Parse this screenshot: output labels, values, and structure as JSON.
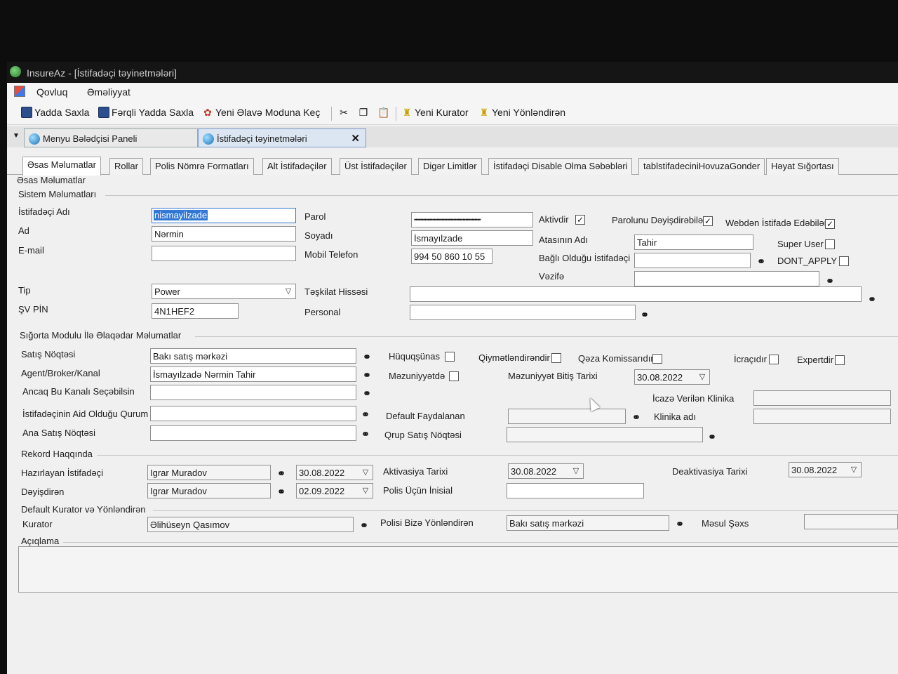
{
  "window": {
    "title": "InsureAz - [İstifadəçi təyinetmələri]"
  },
  "menu": {
    "items": [
      "Qovluq",
      "Əməliyyat"
    ]
  },
  "toolbar": {
    "save": "Yadda Saxla",
    "save_as": "Fərqli Yadda Saxla",
    "new_addon": "Yeni Əlavə Moduna Keç",
    "new_curator": "Yeni Kurator",
    "new_director": "Yeni Yönləndirən"
  },
  "doc_tabs": {
    "nav_panel": "Menyu Bələdçisi Paneli",
    "user_settings": "İstifadəçi təyinetmələri"
  },
  "form_tabs": [
    "Əsas Məlumatlar",
    "Rollar",
    "Polis Nömrə Formatları",
    "Alt İstifadəçilər",
    "Üst İstifadəçilər",
    "Digər Limitlər",
    "İstifadəçi Disable Olma Səbəbləri",
    "tablstifadeciniHovuzaGonder",
    "Həyat Sığortası"
  ],
  "sections": {
    "main": "Əsas Məlumatlar",
    "system": "Sistem Məlumatları",
    "insurance": "Sığorta Modulu İlə Əlaqədar Məlumatlar",
    "record": "Rekord Haqqında",
    "curator": "Default Kurator və Yönləndirən",
    "description": "Açıqlama"
  },
  "system": {
    "username_label": "İstifadəçi Adı",
    "username": "nismayilzade",
    "name_label": "Ad",
    "name": "Nərmin",
    "email_label": "E-mail",
    "email": "",
    "type_label": "Tip",
    "type": "Power",
    "svpin_label": "ŞV PİN",
    "svpin": "4N1HEF2",
    "password_label": "Parol",
    "password": "••••••••••••••••••••••••••••••••••••••••••••",
    "surname_label": "Soyadı",
    "surname": "İsmayılzade",
    "mobile_label": "Mobil Telefon",
    "mobile": "994 50 860 10 55",
    "unit_label": "Təşkilat Hissəsi",
    "unit": "",
    "personal_label": "Personal",
    "personal": "",
    "active_label": "Aktivdir",
    "can_change_pw_label": "Parolunu Dəyişdirəbilər",
    "web_label": "Webdən İstifadə Edəbilər",
    "father_label": "Atasının Adı",
    "father": "Tahir",
    "superuser_label": "Super User",
    "linked_user_label": "Bağlı Olduğu İstifadəçi",
    "linked_user": "",
    "dont_apply_label": "DONT_APPLY",
    "position_label": "Vəzifə",
    "position": ""
  },
  "insurance": {
    "sales_point_label": "Satış Nöqtəsi",
    "sales_point": "Bakı satış mərkəzi",
    "agent_label": "Agent/Broker/Kanal",
    "agent": "İsmayılzadə Nərmin Tahir",
    "only_channel_label": "Ancaq Bu Kanalı Seçəbilsin",
    "only_channel": "",
    "institution_label": "İstifadəçinin Aid Olduğu Qurum",
    "institution": "",
    "main_sales_point_label": "Ana Satış Nöqtəsi",
    "main_sales_point": "",
    "lawyer_label": "Hüquqşünas",
    "appraiser_label": "Qiymətləndirəndir",
    "accident_label": "Qəza Komissarıdır",
    "executor_label": "İcraçıdır",
    "expert_label": "Expertdir",
    "graduate_label": "Məzuniyyətdə",
    "grad_end_label": "Məzuniyyət Bitiş Tarixi",
    "grad_end": "30.08.2022",
    "default_beneficiary_label": "Default Faydalanan",
    "default_beneficiary": "",
    "group_sales_label": "Qrup Satış Nöqtəsi",
    "group_sales": "",
    "permit_clinic_label": "İcazə Verilən Klinika",
    "permit_clinic": "",
    "clinic_name_label": "Klinika adı",
    "clinic_name": ""
  },
  "record": {
    "prepared_label": "Hazırlayan İstifadəçi",
    "prepared_by": "Igrar Muradov",
    "prepared_date": "30.08.2022",
    "changed_label": "Dəyişdirən",
    "changed_by": "Igrar Muradov",
    "changed_date": "02.09.2022",
    "activation_label": "Aktivasiya Tarixi",
    "activation_date": "30.08.2022",
    "deactivation_label": "Deaktivasiya Tarixi",
    "deactivation_date": "30.08.2022",
    "initial_label": "Polis Üçün İnisial",
    "initial": ""
  },
  "curator": {
    "curator_label": "Kurator",
    "curator": "Əlihüseyn Qasımov",
    "director_label": "Polisi Bizə Yönləndirən",
    "director": "Bakı satış mərkəzi",
    "responsible_label": "Məsul Şəxs",
    "responsible": ""
  }
}
